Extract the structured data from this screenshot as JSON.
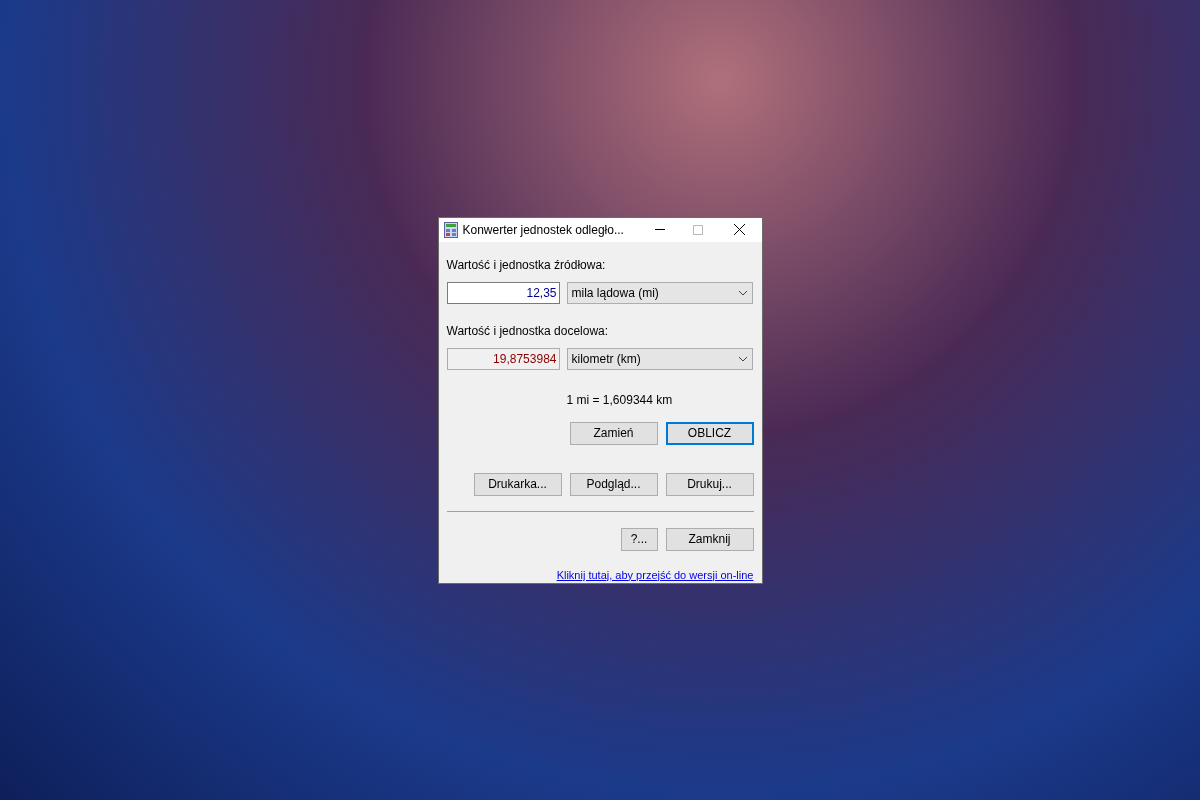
{
  "window": {
    "title": "Konwerter jednostek odległo..."
  },
  "source": {
    "label": "Wartość i jednostka źródłowa:",
    "value": "12,35",
    "readonly": false,
    "unit": "mila lądowa (mi)"
  },
  "target": {
    "label": "Wartość i jednostka docelowa:",
    "value": "19,8753984",
    "readonly": true,
    "unit": "kilometr (km)"
  },
  "ratio": "1 mi = 1,609344 km",
  "action_buttons": [
    {
      "label": "Zamień",
      "focused": false
    },
    {
      "label": "OBLICZ",
      "focused": true
    }
  ],
  "print_buttons": [
    {
      "label": "Drukarka...",
      "focused": false
    },
    {
      "label": "Podgląd...",
      "focused": false
    },
    {
      "label": "Drukuj...",
      "focused": false
    }
  ],
  "bottom_buttons": [
    {
      "label": "?...",
      "focused": false
    },
    {
      "label": "Zamknij",
      "focused": false
    }
  ],
  "link": "Kliknij tutaj, aby przejść do wersji on-line"
}
